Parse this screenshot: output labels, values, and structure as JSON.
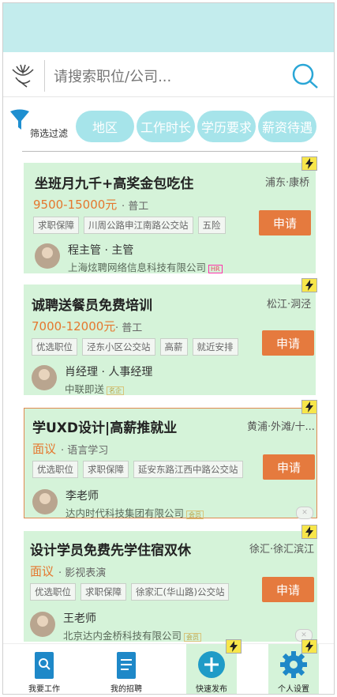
{
  "search": {
    "placeholder": "请搜索职位/公司..."
  },
  "filter": {
    "label": "筛选过滤",
    "chips": [
      "地区",
      "工作时长",
      "学历要求",
      "薪资待遇"
    ]
  },
  "jobs": [
    {
      "title": "坐班月九千+高奖金包吃住",
      "location": "浦东·康桥",
      "salary": "9500-15000元",
      "type": "· 普工",
      "tags": [
        "求职保障",
        "川周公路申江南路公交站",
        "五险"
      ],
      "apply": "申请",
      "person": "程主管 · 主管",
      "company": "上海炫聘网络信息科技有限公司",
      "badge": "HR"
    },
    {
      "title": "诚聘送餐员免费培训",
      "location": "松江·洞泾",
      "salary": "7000-12000元",
      "type": "· 普工",
      "tags": [
        "优选职位",
        "泾东小区公交站",
        "高薪",
        "就近安排"
      ],
      "apply": "申请",
      "person": "肖经理 · 人事经理",
      "company": "中联即送",
      "badge": "名企"
    },
    {
      "title": "学UXD设计|高薪推就业",
      "location": "黄浦·外滩/十...",
      "salary": "面议",
      "type": "· 语言学习",
      "tags": [
        "优选职位",
        "求职保障",
        "延安东路江西中路公交站"
      ],
      "apply": "申请",
      "person": "李老师",
      "company": "达内时代科技集团有限公司",
      "badge": "会员"
    },
    {
      "title": "设计学员免费先学住宿双休",
      "location": "徐汇·徐汇滨江",
      "salary": "面议",
      "type": "· 影视表演",
      "tags": [
        "优选职位",
        "求职保障",
        "徐家汇(华山路)公交站"
      ],
      "apply": "申请",
      "person": "王老师",
      "company": "北京达内金桥科技有限公司",
      "badge": "会员"
    }
  ],
  "tabs": [
    {
      "label": "我要工作",
      "icon": "search-document-icon"
    },
    {
      "label": "我的招聘",
      "icon": "document-icon"
    },
    {
      "label": "快速发布",
      "icon": "plus-circle-icon"
    },
    {
      "label": "个人设置",
      "icon": "gear-icon"
    }
  ],
  "colors": {
    "accent": "#a6e4ea",
    "card": "#d5f3d9",
    "apply": "#e57a3e",
    "salary": "#e5772e",
    "tabBlue": "#1e88c8"
  }
}
